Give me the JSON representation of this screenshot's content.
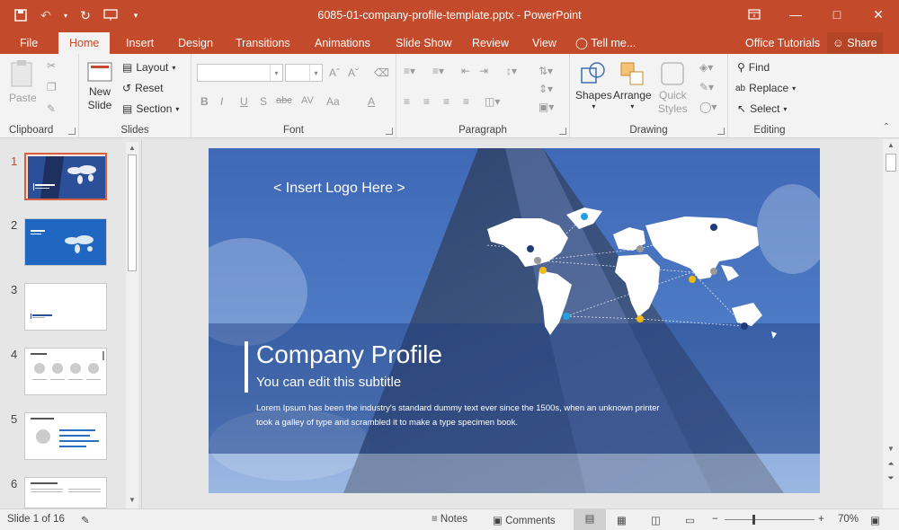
{
  "window": {
    "title": "6085-01-company-profile-template.pptx - PowerPoint",
    "controls": [
      "restore-ribbon",
      "minimize",
      "maximize",
      "close"
    ]
  },
  "tabs": [
    {
      "label": "File"
    },
    {
      "label": "Home",
      "active": true
    },
    {
      "label": "Insert"
    },
    {
      "label": "Design"
    },
    {
      "label": "Transitions"
    },
    {
      "label": "Animations"
    },
    {
      "label": "Slide Show"
    },
    {
      "label": "Review"
    },
    {
      "label": "View"
    }
  ],
  "tell_me": "Tell me...",
  "office_tutorials": "Office Tutorials",
  "share": "Share",
  "ribbon": {
    "clipboard": {
      "label": "Clipboard",
      "paste": "Paste"
    },
    "slides": {
      "label": "Slides",
      "new_slide_1": "New",
      "new_slide_2": "Slide",
      "layout": "Layout",
      "reset": "Reset",
      "section": "Section"
    },
    "font": {
      "label": "Font",
      "buttons": [
        "B",
        "I",
        "U",
        "S",
        "abc",
        "AV",
        "Aa",
        "A"
      ]
    },
    "paragraph": {
      "label": "Paragraph"
    },
    "drawing": {
      "label": "Drawing",
      "shapes": "Shapes",
      "arrange": "Arrange",
      "quick_styles_1": "Quick",
      "quick_styles_2": "Styles"
    },
    "editing": {
      "label": "Editing",
      "find": "Find",
      "replace": "Replace",
      "select": "Select"
    }
  },
  "thumbnails": [
    "1",
    "2",
    "3",
    "4",
    "5",
    "6"
  ],
  "slide": {
    "logo_placeholder": "< Insert Logo Here >",
    "title": "Company Profile",
    "subtitle": "You can edit this subtitle",
    "body_line1": "Lorem Ipsum has been the industry's standard dummy text ever since the 1500s, when an unknown printer",
    "body_line2": "took a galley of type and scrambled it to make a type specimen book."
  },
  "status": {
    "slide_counter": "Slide 1 of 16",
    "notes": "Notes",
    "comments": "Comments",
    "zoom": "70%"
  },
  "colors": {
    "accent": "#c34a2a",
    "slide_blue": "#3a64b0",
    "map_dot_yellow": "#f5b80f",
    "map_dot_blue": "#1fa0e0",
    "map_dot_navy": "#1e3a78",
    "map_dot_grey": "#9a9a9a"
  }
}
